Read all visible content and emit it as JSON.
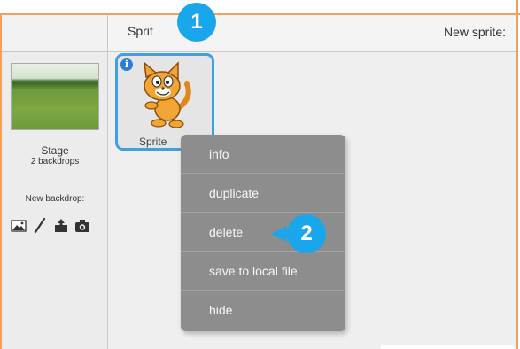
{
  "stage": {
    "name": "Stage",
    "backdrop_count": "2 backdrops",
    "new_backdrop_label": "New backdrop:"
  },
  "sprites_pane": {
    "title": "Sprit",
    "new_sprite_label": "New sprite:"
  },
  "sprite": {
    "name": "Sprite"
  },
  "context_menu": {
    "items": [
      "info",
      "duplicate",
      "delete",
      "save to local file",
      "hide"
    ]
  },
  "callouts": {
    "step1": "1",
    "step2": "2"
  },
  "icons": {
    "paint_backdrop": "image-icon",
    "paint_new": "paintbrush-icon",
    "upload": "upload-icon",
    "camera": "camera-icon",
    "info": "info-icon"
  },
  "colors": {
    "callout": "#1aa6ea",
    "selection": "#3da0e0",
    "frame": "#f0a25a",
    "menu": "#8d8d8d"
  }
}
